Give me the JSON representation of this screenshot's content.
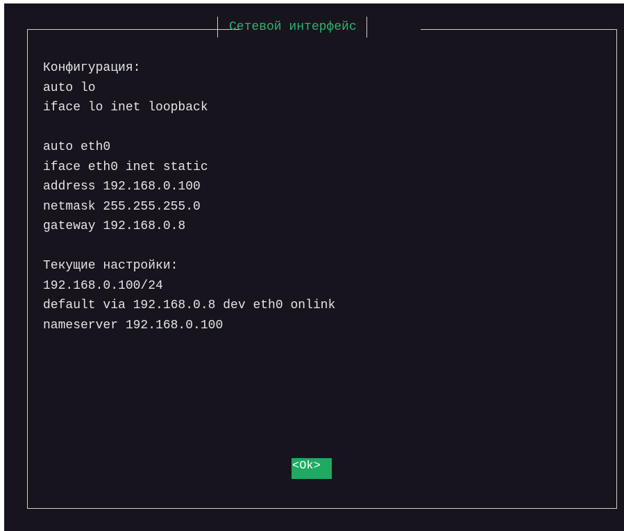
{
  "dialog": {
    "title": "Сетевой интерфейс",
    "lines": [
      "Конфигурация:",
      "auto lo",
      "iface lo inet loopback",
      "",
      "auto eth0",
      "iface eth0 inet static",
      "address 192.168.0.100",
      "netmask 255.255.255.0",
      "gateway 192.168.0.8",
      "",
      "Текущие настройки:",
      "192.168.0.100/24",
      "default via 192.168.0.8 dev eth0 onlink",
      "nameserver 192.168.0.100"
    ],
    "ok_label": "<Ok>"
  },
  "colors": {
    "background": "#17141e",
    "text": "#e4e4e4",
    "border": "#d0d0d0",
    "accent": "#1faa63",
    "title": "#2fb26e"
  }
}
